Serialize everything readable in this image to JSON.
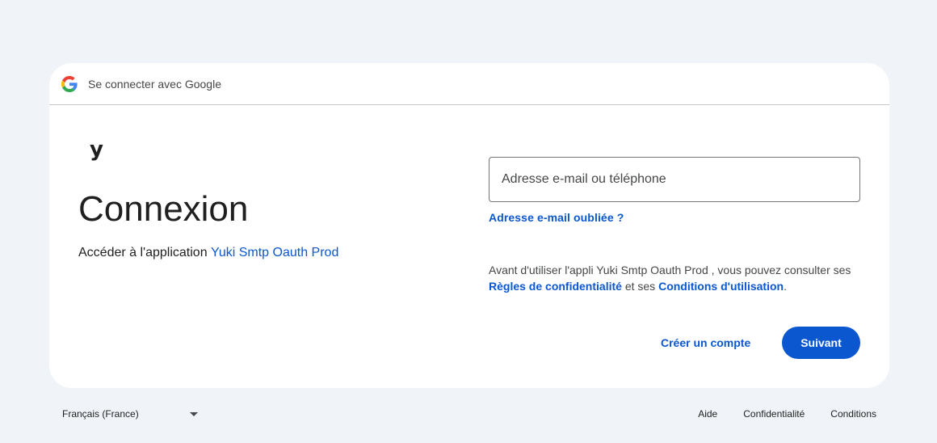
{
  "header": {
    "title": "Se connecter avec Google",
    "icon": "google-g-icon"
  },
  "app": {
    "logo_text": "y"
  },
  "main": {
    "title": "Connexion",
    "subtitle_prefix": "Accéder à l'application ",
    "app_name": "Yuki Smtp Oauth Prod"
  },
  "form": {
    "email_placeholder": "Adresse e-mail ou téléphone",
    "email_value": "",
    "forgot_link": "Adresse e-mail oubliée ?"
  },
  "privacy": {
    "text_before": "Avant d'utiliser l'appli Yuki Smtp Oauth Prod , vous pouvez consulter ses ",
    "privacy_link": "Règles de confidentialité",
    "text_middle": " et ses ",
    "terms_link": "Conditions d'utilisation",
    "text_after": "."
  },
  "actions": {
    "create_account": "Créer un compte",
    "next": "Suivant"
  },
  "footer": {
    "language": "Français (France)",
    "links": [
      "Aide",
      "Confidentialité",
      "Conditions"
    ]
  },
  "colors": {
    "accent": "#0b57d0",
    "background": "#f0f4f9",
    "card": "#ffffff"
  }
}
